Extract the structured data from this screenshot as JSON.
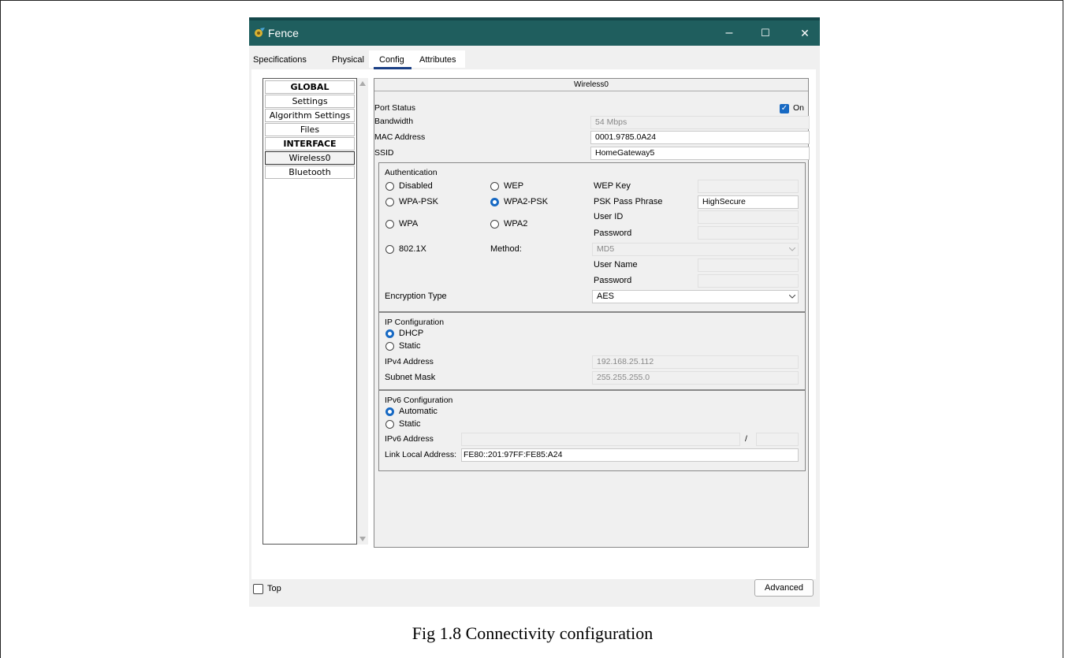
{
  "window": {
    "title": "Fence",
    "minimize": "–",
    "maximize": "☐",
    "close": "✕"
  },
  "tabs": [
    "Specifications",
    "Physical",
    "Config",
    "Attributes"
  ],
  "nav": {
    "items": [
      {
        "label": "GLOBAL",
        "bold": true
      },
      {
        "label": "Settings"
      },
      {
        "label": "Algorithm Settings"
      },
      {
        "label": "Files"
      },
      {
        "label": "INTERFACE",
        "bold": true
      },
      {
        "label": "Wireless0",
        "selected": true
      },
      {
        "label": "Bluetooth"
      }
    ]
  },
  "panel": {
    "title": "Wireless0",
    "port_status_label": "Port Status",
    "port_on_label": "On",
    "bandwidth_label": "Bandwidth",
    "bandwidth_value": "54 Mbps",
    "mac_label": "MAC Address",
    "mac_value": "0001.9785.0A24",
    "ssid_label": "SSID",
    "ssid_value": "HomeGateway5",
    "auth": {
      "title": "Authentication",
      "disabled": "Disabled",
      "wep": "WEP",
      "wpapsk": "WPA-PSK",
      "wpa2psk": "WPA2-PSK",
      "wpa": "WPA",
      "wpa2": "WPA2",
      "dot1x": "802.1X",
      "method_label": "Method:",
      "wep_key_label": "WEP Key",
      "psk_label": "PSK Pass Phrase",
      "psk_value": "HighSecure",
      "userid_label": "User ID",
      "password_label": "Password",
      "method_value": "MD5",
      "username_label": "User Name",
      "password2_label": "Password",
      "enc_label": "Encryption Type",
      "enc_value": "AES"
    },
    "ip": {
      "title": "IP Configuration",
      "dhcp": "DHCP",
      "static": "Static",
      "ipv4_label": "IPv4 Address",
      "ipv4_value": "192.168.25.112",
      "mask_label": "Subnet Mask",
      "mask_value": "255.255.255.0"
    },
    "ipv6": {
      "title": "IPv6 Configuration",
      "automatic": "Automatic",
      "static": "Static",
      "addr_label": "IPv6 Address",
      "slash": "/",
      "link_label": "Link Local Address:",
      "link_value": "FE80::201:97FF:FE85:A24"
    }
  },
  "bottom": {
    "top_label": "Top",
    "advanced_label": "Advanced"
  },
  "caption": "Fig 1.8 Connectivity configuration"
}
